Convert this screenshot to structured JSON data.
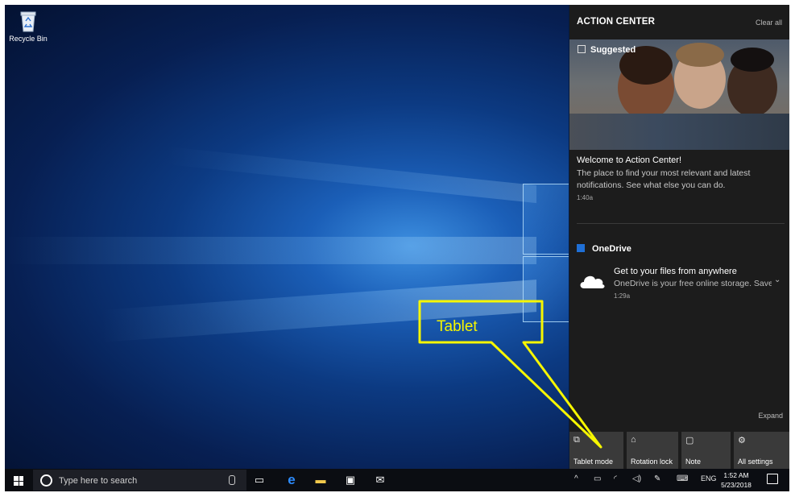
{
  "desktop": {
    "icons": [
      {
        "label": "Recycle Bin",
        "icon": "recycle-bin-icon"
      }
    ]
  },
  "callout": {
    "text": "Tablet",
    "color": "#f6f600"
  },
  "action_center": {
    "title": "ACTION CENTER",
    "clear_all": "Clear all",
    "notifications": [
      {
        "header": "Suggested",
        "title": "Welcome to Action Center!",
        "body": "The place to find your most relevant and latest notifications. See what else you can do.",
        "time": "1:40a"
      },
      {
        "app": "OneDrive",
        "title": "Get to your files from anywhere",
        "body": "OneDrive is your free online storage. Save",
        "time": "1:29a"
      }
    ],
    "expand": "Expand",
    "quick_actions": [
      {
        "label": "Tablet mode",
        "icon": "tablet-mode-icon",
        "glyph": "⧉"
      },
      {
        "label": "Rotation lock",
        "icon": "rotation-lock-icon",
        "glyph": "⌂"
      },
      {
        "label": "Note",
        "icon": "note-icon",
        "glyph": "▢"
      },
      {
        "label": "All settings",
        "icon": "gear-icon",
        "glyph": "⚙"
      }
    ]
  },
  "taskbar": {
    "search_placeholder": "Type here to search",
    "pinned": [
      {
        "icon": "task-view-icon",
        "glyph": "▭"
      },
      {
        "icon": "edge-icon",
        "glyph": "e"
      },
      {
        "icon": "file-explorer-icon",
        "glyph": "▬"
      },
      {
        "icon": "store-icon",
        "glyph": "▣"
      },
      {
        "icon": "mail-icon",
        "glyph": "✉"
      }
    ],
    "tray": {
      "chevron": "^",
      "language": "ENG",
      "time": "1:52 AM",
      "date": "5/23/2018"
    }
  }
}
